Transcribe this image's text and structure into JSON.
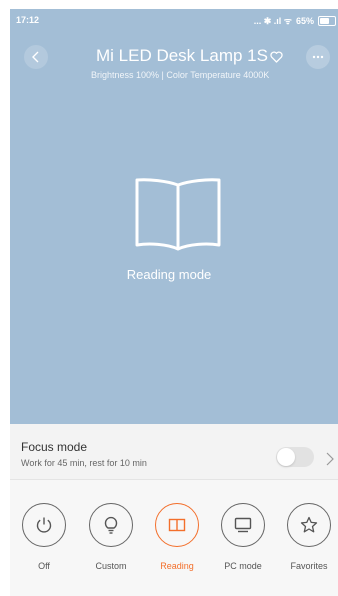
{
  "status_bar": {
    "time": "17:12",
    "indicators": "... ✱ .ıl ᯤ",
    "battery": "65%",
    "battery_level": 0.65
  },
  "header": {
    "title": "Mi LED Desk Lamp 1S",
    "subtitle": "Brightness 100% | Color Temperature 4000K",
    "icons": [
      "back-arrow-icon",
      "heart-icon",
      "more-icon"
    ]
  },
  "hero": {
    "icon": "open-book-icon",
    "mode_label": "Reading mode"
  },
  "focus_mode": {
    "title": "Focus mode",
    "description": "Work for 45 min, rest for 10 min",
    "enabled": false
  },
  "modes": [
    {
      "label": "Off",
      "icon": "power-icon",
      "active": false
    },
    {
      "label": "Custom",
      "icon": "bulb-icon",
      "active": false
    },
    {
      "label": "Reading",
      "icon": "book-icon",
      "active": true
    },
    {
      "label": "PC mode",
      "icon": "monitor-icon",
      "active": false
    },
    {
      "label": "Favorites",
      "icon": "star-icon",
      "active": false
    }
  ],
  "colors": {
    "hero_bg": "#a3bed6",
    "accent": "#f36f2b"
  }
}
